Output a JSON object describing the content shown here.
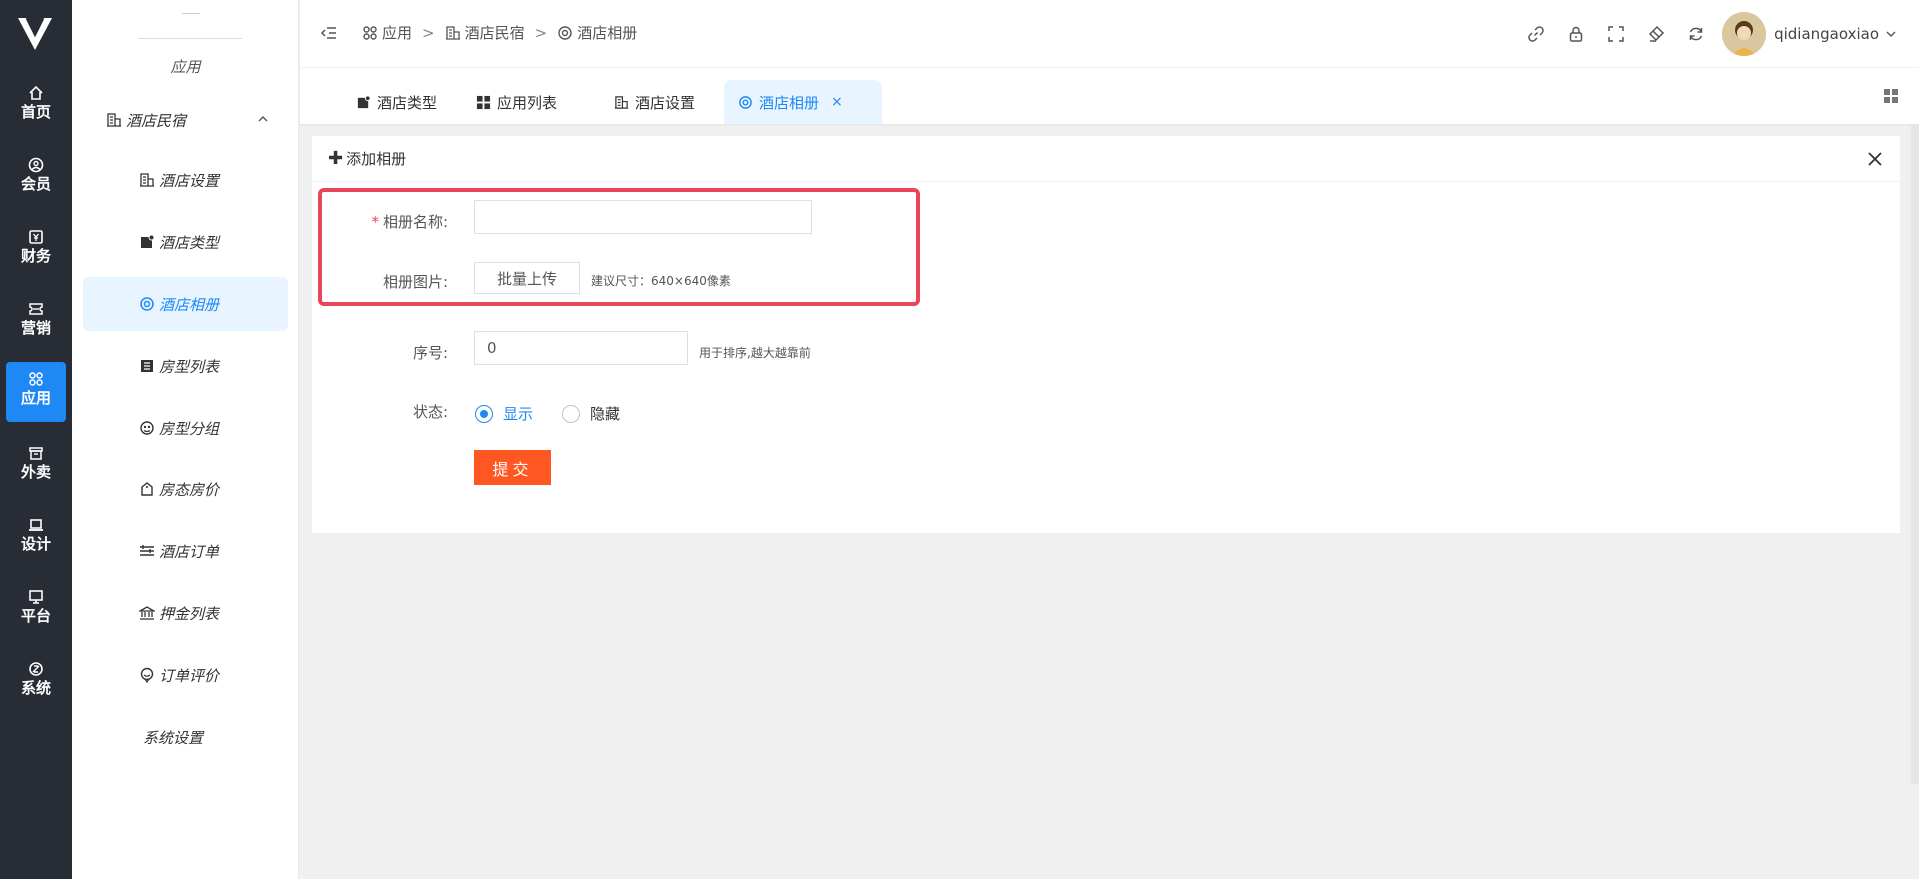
{
  "leftnav": {
    "items": [
      {
        "label": "首页",
        "icon": "home-icon"
      },
      {
        "label": "会员",
        "icon": "user-icon"
      },
      {
        "label": "财务",
        "icon": "finance-icon"
      },
      {
        "label": "营销",
        "icon": "ticket-icon"
      },
      {
        "label": "应用",
        "icon": "apps-icon",
        "active": true
      },
      {
        "label": "外卖",
        "icon": "box-icon"
      },
      {
        "label": "设计",
        "icon": "laptop-icon"
      },
      {
        "label": "平台",
        "icon": "monitor-icon"
      },
      {
        "label": "系统",
        "icon": "settings-icon"
      }
    ]
  },
  "submenu": {
    "group_title": "应用",
    "parent": {
      "label": "酒店民宿",
      "icon": "building-icon"
    },
    "items": [
      {
        "label": "酒店设置",
        "icon": "building-icon"
      },
      {
        "label": "酒店类型",
        "icon": "tag-icon"
      },
      {
        "label": "酒店相册",
        "icon": "target-icon",
        "active": true
      },
      {
        "label": "房型列表",
        "icon": "list-icon"
      },
      {
        "label": "房型分组",
        "icon": "group-icon"
      },
      {
        "label": "房态房价",
        "icon": "price-tag-icon"
      },
      {
        "label": "酒店订单",
        "icon": "order-lines-icon"
      },
      {
        "label": "押金列表",
        "icon": "bank-icon"
      },
      {
        "label": "订单评价",
        "icon": "comment-icon"
      },
      {
        "label": "系统设置",
        "icon": ""
      }
    ]
  },
  "header": {
    "breadcrumb": [
      {
        "label": "应用",
        "icon": "apps-icon"
      },
      {
        "label": "酒店民宿",
        "icon": "building-icon"
      },
      {
        "label": "酒店相册",
        "icon": "target-icon"
      }
    ],
    "separator": ">",
    "username": "qidiangaoxiao",
    "tools": [
      "link-icon",
      "lock-icon",
      "fullscreen-icon",
      "clear-icon",
      "refresh-icon"
    ]
  },
  "tabs": [
    {
      "label": "酒店类型",
      "icon": "tag-icon"
    },
    {
      "label": "应用列表",
      "icon": "grid-icon"
    },
    {
      "label": "酒店设置",
      "icon": "building-icon"
    },
    {
      "label": "酒店相册",
      "icon": "target-icon",
      "active": true,
      "close": "×"
    }
  ],
  "panel": {
    "title_prefix": "✚",
    "title": "添加相册",
    "form": {
      "album_name_label": "相册名称:",
      "album_name_required": "*",
      "album_name_value": "",
      "album_images_label": "相册图片:",
      "upload_button": "批量上传",
      "upload_hint": "建议尺寸：640×640像素",
      "order_label": "序号:",
      "order_value": "0",
      "order_hint": "用于排序,越大越靠前",
      "status_label": "状态:",
      "status_options": [
        "显示",
        "隐藏"
      ],
      "status_selected": "显示",
      "submit_label": "提交"
    }
  },
  "colors": {
    "sidebar_bg": "#282c34",
    "accent": "#1e88f5",
    "submit": "#ff5722",
    "highlight_box": "#e8475a"
  }
}
